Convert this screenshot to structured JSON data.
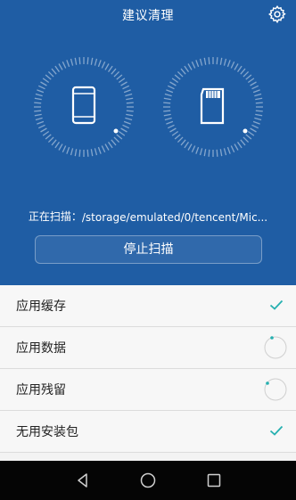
{
  "header": {
    "title": "建议清理",
    "settings_icon": "gear-icon"
  },
  "storage": {
    "phone_icon": "phone-icon",
    "sd_icon": "sd-card-icon"
  },
  "scan": {
    "prefix": "正在扫描：",
    "path": "/storage/emulated/0/tencent/Mic..."
  },
  "stop_button": {
    "label": "停止扫描"
  },
  "items": [
    {
      "label": "应用缓存",
      "status": "done"
    },
    {
      "label": "应用数据",
      "status": "scanning"
    },
    {
      "label": "应用残留",
      "status": "scanning"
    },
    {
      "label": "无用安装包",
      "status": "done"
    }
  ],
  "navbar": {
    "back_icon": "back-icon",
    "home_icon": "home-icon",
    "recent_icon": "recent-apps-icon"
  },
  "colors": {
    "accent": "#26b0b0",
    "top_bg": "#1f5da4",
    "nav_bg": "#050505"
  }
}
